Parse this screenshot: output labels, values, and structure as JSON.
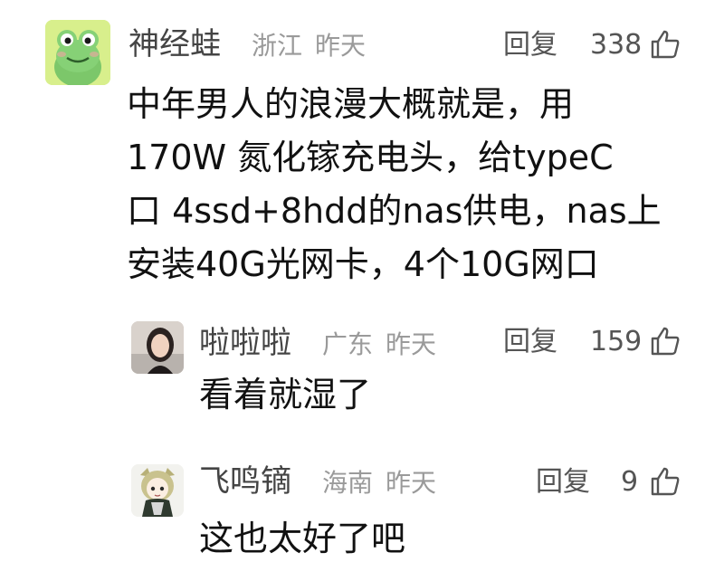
{
  "comments": [
    {
      "username": "神经蛙",
      "location": "浙江",
      "time": "昨天",
      "reply_label": "回复",
      "likes": "338",
      "avatar_icon": "frog-avatar",
      "text_lines": [
        "中年男人的浪漫大概就是，用",
        "170W 氮化镓充电头，给typeC",
        "口 4ssd+8hdd的nas供电，nas上",
        "安装40G光网卡，4个10G网口"
      ]
    },
    {
      "username": "啦啦啦",
      "location": "广东",
      "time": "昨天",
      "reply_label": "回复",
      "likes": "159",
      "avatar_icon": "person-photo-avatar",
      "text": "看着就湿了"
    },
    {
      "username": "飞鸣镝",
      "location": "海南",
      "time": "昨天",
      "reply_label": "回复",
      "likes": "9",
      "avatar_icon": "anime-character-avatar",
      "text": "这也太好了吧"
    }
  ],
  "colors": {
    "username": "#444444",
    "meta": "#9a9a9a",
    "text": "#111111",
    "frog_green": "#7cc76a",
    "frog_bg": "#d8ef8c"
  }
}
